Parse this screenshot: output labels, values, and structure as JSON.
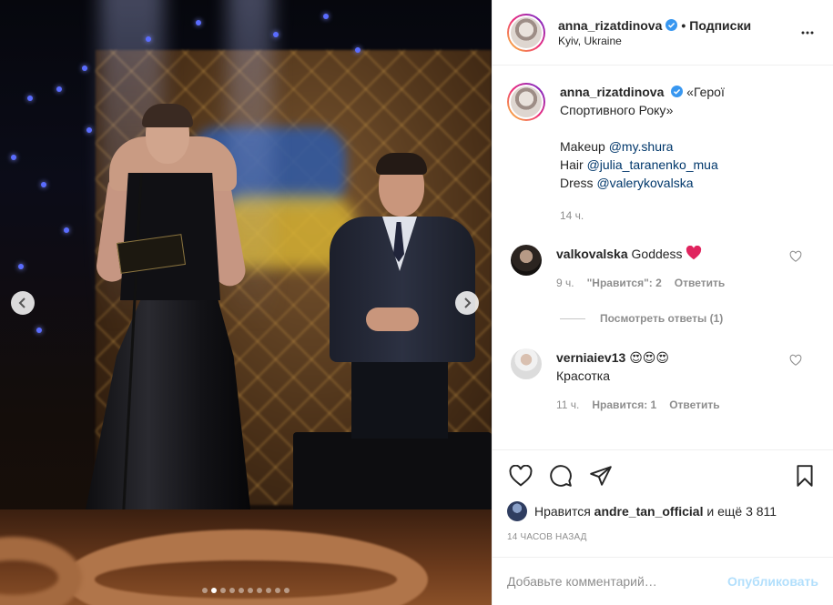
{
  "colors": {
    "link": "#00376b",
    "verified": "#3897f0",
    "muted": "#8e8e8e",
    "post_disabled": "#b2dffc",
    "heart_red": "#ed4956"
  },
  "photo": {
    "nav_prev_icon": "chevron-left-icon",
    "nav_next_icon": "chevron-right-icon",
    "carousel": {
      "total": 10,
      "active": 2
    }
  },
  "header": {
    "username": "anna_rizatdinova",
    "separator": "•",
    "follow_label": "Подписки",
    "location": "Kyiv, Ukraine",
    "more_icon": "more-options-icon"
  },
  "caption": {
    "username": "anna_rizatdinova",
    "text_line1": "«Герої",
    "text_line2": "Спортивного Року»",
    "makeup_label": "Makeup",
    "makeup_handle": "@my.shura",
    "hair_label": "Hair",
    "hair_handle": "@julia_taranenko_mua",
    "dress_label": "Dress",
    "dress_handle": "@valerykovalska",
    "time": "14 ч."
  },
  "comments": [
    {
      "username": "valkovalska",
      "text": "Goddess",
      "emoji": "❤️",
      "time": "9 ч.",
      "likes_label": "\"Нравится\": 2",
      "reply_label": "Ответить",
      "view_replies": "Посмотреть ответы (1)"
    },
    {
      "username": "verniaiev13",
      "text": "😍😍😍",
      "text_line2": "Красотка",
      "time": "11 ч.",
      "likes_label": "Нравится: 1",
      "reply_label": "Ответить"
    }
  ],
  "actions": {
    "like_icon": "heart-icon",
    "comment_icon": "comment-icon",
    "share_icon": "share-icon",
    "save_icon": "bookmark-icon"
  },
  "likes": {
    "prefix": "Нравится",
    "user": "andre_tan_official",
    "suffix": "и ещё 3 811"
  },
  "time_ago": "14 часов назад",
  "add_comment": {
    "placeholder": "Добавьте комментарий…",
    "post_label": "Опубликовать"
  }
}
